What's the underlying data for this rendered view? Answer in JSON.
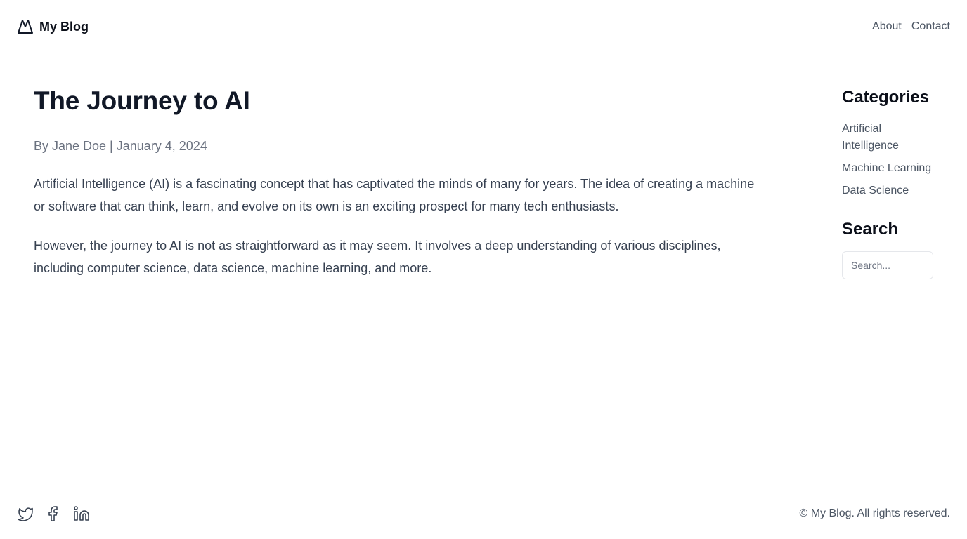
{
  "header": {
    "brand_name": "My Blog",
    "brand_icon": "mountain-logo-icon",
    "nav": [
      {
        "label": "About"
      },
      {
        "label": "Contact"
      }
    ]
  },
  "article": {
    "title": "The Journey to AI",
    "meta": "By Jane Doe | January 4, 2024",
    "paragraphs": [
      "Artificial Intelligence (AI) is a fascinating concept that has captivated the minds of many for years. The idea of creating a machine or software that can think, learn, and evolve on its own is an exciting prospect for many tech enthusiasts.",
      "However, the journey to AI is not as straightforward as it may seem. It involves a deep understanding of various disciplines, including computer science, data science, machine learning, and more."
    ]
  },
  "sidebar": {
    "categories_heading": "Categories",
    "categories": [
      {
        "label": "Artificial Intelligence"
      },
      {
        "label": "Machine Learning"
      },
      {
        "label": "Data Science"
      }
    ],
    "search_heading": "Search",
    "search_placeholder": "Search..."
  },
  "footer": {
    "social_icons": [
      "twitter-icon",
      "facebook-icon",
      "linkedin-icon"
    ],
    "copyright": "© My Blog. All rights reserved."
  },
  "colors": {
    "heading": "#111827",
    "body_text": "#374151",
    "muted_text": "#6b7280",
    "link_text": "#4b5563",
    "border": "#e5e7eb"
  }
}
